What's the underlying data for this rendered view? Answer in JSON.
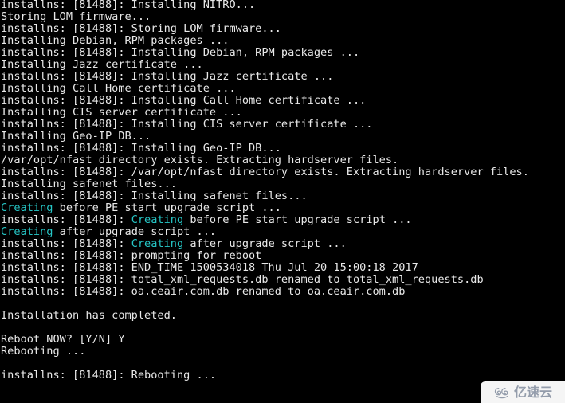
{
  "terminal": {
    "background_color": "#000000",
    "text_color": "#e8e8e8",
    "highlight_color": "#26c6c6",
    "lines": [
      {
        "text": "installns: [81488]: Installing NITRO..."
      },
      {
        "text": "Storing LOM firmware..."
      },
      {
        "text": "installns: [81488]: Storing LOM firmware..."
      },
      {
        "text": "Installing Debian, RPM packages ..."
      },
      {
        "text": "installns: [81488]: Installing Debian, RPM packages ..."
      },
      {
        "text": "Installing Jazz certificate ..."
      },
      {
        "text": "installns: [81488]: Installing Jazz certificate ..."
      },
      {
        "text": "Installing Call Home certificate ..."
      },
      {
        "text": "installns: [81488]: Installing Call Home certificate ..."
      },
      {
        "text": "Installing CIS server certificate ..."
      },
      {
        "text": "installns: [81488]: Installing CIS server certificate ..."
      },
      {
        "text": "Installing Geo-IP DB..."
      },
      {
        "text": "installns: [81488]: Installing Geo-IP DB..."
      },
      {
        "text": "/var/opt/nfast directory exists. Extracting hardserver files."
      },
      {
        "text": "installns: [81488]: /var/opt/nfast directory exists. Extracting hardserver files."
      },
      {
        "text": "Installing safenet files..."
      },
      {
        "text": "installns: [81488]: Installing safenet files..."
      },
      {
        "text": "Creating before PE start upgrade script ...",
        "highlight": "Creating"
      },
      {
        "text": "installns: [81488]: Creating before PE start upgrade script ...",
        "highlight": "Creating"
      },
      {
        "text": "Creating after upgrade script ...",
        "highlight": "Creating"
      },
      {
        "text": "installns: [81488]: Creating after upgrade script ...",
        "highlight": "Creating"
      },
      {
        "text": "installns: [81488]: prompting for reboot"
      },
      {
        "text": "installns: [81488]: END_TIME 1500534018 Thu Jul 20 15:00:18 2017"
      },
      {
        "text": "installns: [81488]: total_xml_requests.db renamed to total_xml_requests.db"
      },
      {
        "text": "installns: [81488]: oa.ceair.com.db renamed to oa.ceair.com.db"
      },
      {
        "text": ""
      },
      {
        "text": "Installation has completed."
      },
      {
        "text": ""
      },
      {
        "text": "Reboot NOW? [Y/N] Y"
      },
      {
        "text": "Rebooting ..."
      },
      {
        "text": ""
      },
      {
        "text": "installns: [81488]: Rebooting ..."
      }
    ]
  },
  "watermark": {
    "icon": "cloud-swirl-icon",
    "text": "亿速云",
    "color": "#9aa3b2",
    "background_color": "#ffffff"
  }
}
